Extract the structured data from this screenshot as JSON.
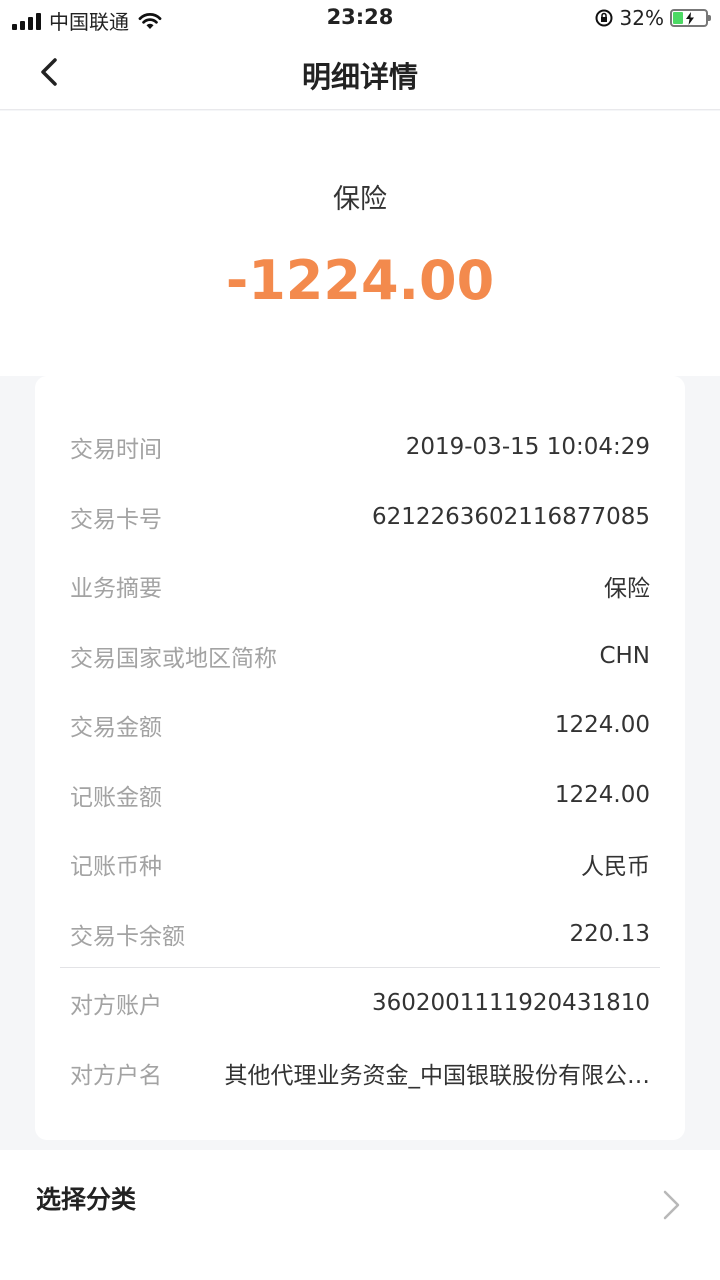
{
  "status_bar": {
    "carrier": "中国联通",
    "time": "23:28",
    "battery": "32%"
  },
  "nav": {
    "title": "明细详情",
    "back_icon": "chevron-left-icon"
  },
  "summary": {
    "category": "保险",
    "amount": "-1224.00",
    "amount_color": "#f38a4d"
  },
  "details": [
    {
      "label": "交易时间",
      "value": "2019-03-15 10:04:29"
    },
    {
      "label": "交易卡号",
      "value": "6212263602116877085"
    },
    {
      "label": "业务摘要",
      "value": "保险"
    },
    {
      "label": "交易国家或地区简称",
      "value": "CHN"
    },
    {
      "label": "交易金额",
      "value": "1224.00"
    },
    {
      "label": "记账金额",
      "value": "1224.00"
    },
    {
      "label": "记账币种",
      "value": "人民币"
    },
    {
      "label": "交易卡余额",
      "value": "220.13"
    },
    {
      "label": "对方账户",
      "value": "3602001111920431810"
    },
    {
      "label": "对方户名",
      "value": "其他代理业务资金_中国银联股份有限公…"
    }
  ],
  "category_select": {
    "label": "选择分类",
    "icon": "chevron-right-icon"
  }
}
